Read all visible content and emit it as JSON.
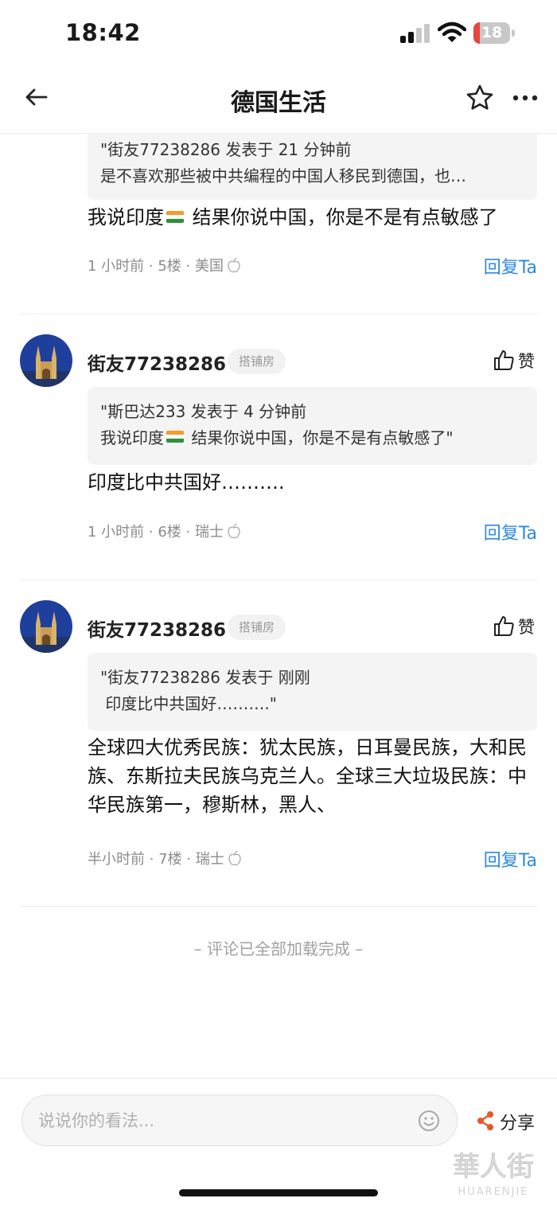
{
  "status": {
    "time": "18:42",
    "battery": "18",
    "battery_fraction": 0.18
  },
  "nav": {
    "title": "德国生活"
  },
  "comments": [
    {
      "quote_line1": "\"街友77238286 发表于 21 分钟前",
      "quote_line2": "是不喜欢那些被中共编程的中国人移民到德国，也…",
      "text_before_flag": "我说印度",
      "text_after_flag": " 结果你说中国，你是不是有点敏感了",
      "time": "1 小时前",
      "floor": "5楼",
      "location": "美国",
      "reply_label": "回复Ta"
    },
    {
      "username": "街友77238286",
      "badge": "搭铺房",
      "like_label": "赞",
      "quote_line1": "\"斯巴达233 发表于 4 分钟前",
      "quote_line2_before_flag": "我说印度",
      "quote_line2_after_flag": " 结果你说中国，你是不是有点敏感了\"",
      "text": "印度比中共国好……….",
      "time": "1 小时前",
      "floor": "6楼",
      "location": "瑞士",
      "reply_label": "回复Ta"
    },
    {
      "username": "街友77238286",
      "badge": "搭铺房",
      "like_label": "赞",
      "quote_line1": "\"街友77238286 发表于 刚刚",
      "quote_line2": " 印度比中共国好……….\"",
      "text": "全球四大优秀民族：犹太民族，日耳曼民族，大和民族、东斯拉夫民族乌克兰人。全球三大垃圾民族：中华民族第一，穆斯林，黑人、",
      "time": "半小时前",
      "floor": "7楼",
      "location": "瑞士",
      "reply_label": "回复Ta"
    }
  ],
  "meta_separator": " · ",
  "loaded_note": "– 评论已全部加载完成 –",
  "bottom": {
    "input_placeholder": "说说你的看法...",
    "share_label": "分享"
  },
  "watermark": {
    "line1": "華人街",
    "line2": "HUARENJIE"
  },
  "colors": {
    "accent": "#2e8ae0",
    "battery": "#e5463d",
    "share": "#e8562a"
  }
}
